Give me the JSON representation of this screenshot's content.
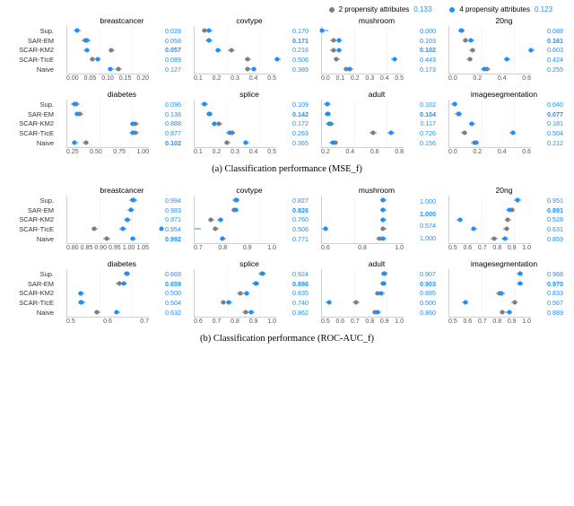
{
  "legend": {
    "a": {
      "label": "2 propensity attributes",
      "value": "0.133"
    },
    "b": {
      "label": "4 propensity attributes",
      "value": "0.123"
    }
  },
  "methods": [
    "Sup.",
    "SAR-EM",
    "SCAR-KM2",
    "SCAR-TIcE",
    "Naive"
  ],
  "captions": {
    "a": "(a) Classification performance (MSE_f)",
    "b": "(b) Classification performance (ROC-AUC_f)"
  },
  "groups": {
    "a": {
      "row1": [
        {
          "title": "breastcancer",
          "xmin": 0.0,
          "xmax": 0.24,
          "xticks": [
            "0.00",
            "0.05",
            "0.10",
            "0.15",
            "0.20"
          ],
          "vals": [
            "0.028",
            "0.058",
            "0.057",
            "0.089",
            "0.127"
          ],
          "bold": 2,
          "pts": [
            {
              "g": 0.03,
              "b": 0.028
            },
            {
              "g": 0.052,
              "b": 0.058
            },
            {
              "g": 0.13,
              "b": 0.057
            },
            {
              "g": 0.075,
              "b": 0.089
            },
            {
              "g": 0.15,
              "b": 0.127
            }
          ]
        },
        {
          "title": "covtype",
          "xmin": 0.1,
          "xmax": 0.5,
          "xticks": [
            "0.1",
            "0.2",
            "0.3",
            "0.4",
            "0.5"
          ],
          "vals": [
            "0.170",
            "0.171",
            "0.216",
            "0.506",
            "0.389"
          ],
          "bold": 1,
          "pts": [
            {
              "g": 0.15,
              "b": 0.17
            },
            {
              "g": 0.17,
              "b": 0.171
            },
            {
              "g": 0.28,
              "b": 0.216
            },
            {
              "g": 0.36,
              "b": 0.506
            },
            {
              "g": 0.36,
              "b": 0.389
            }
          ]
        },
        {
          "title": "mushroom",
          "xmin": 0.0,
          "xmax": 0.5,
          "xticks": [
            "0.0",
            "0.1",
            "0.2",
            "0.3",
            "0.4",
            "0.5"
          ],
          "vals": [
            "0.000",
            "0.103",
            "0.102",
            "0.443",
            "0.173"
          ],
          "bold": 2,
          "pts": [
            {
              "g": 0.0,
              "b": 0.0
            },
            {
              "g": 0.07,
              "b": 0.103
            },
            {
              "g": 0.07,
              "b": 0.102
            },
            {
              "g": 0.09,
              "b": 0.443
            },
            {
              "g": 0.15,
              "b": 0.173
            }
          ]
        },
        {
          "title": "20ng",
          "xmin": 0.0,
          "xmax": 0.6,
          "xticks": [
            "0.0",
            "0.2",
            "0.4",
            "0.6"
          ],
          "vals": [
            "0.088",
            "0.161",
            "0.603",
            "0.424",
            "0.255"
          ],
          "bold": 1,
          "pts": [
            {
              "g": 0.09,
              "b": 0.088
            },
            {
              "g": 0.12,
              "b": 0.161
            },
            {
              "g": 0.17,
              "b": 0.603
            },
            {
              "g": 0.15,
              "b": 0.424
            },
            {
              "g": 0.28,
              "b": 0.255
            }
          ]
        }
      ],
      "row2": [
        {
          "title": "diabetes",
          "xmin": 0.0,
          "xmax": 1.1,
          "xticks": [
            "0.25",
            "0.50",
            "0.75",
            "1.00"
          ],
          "vals": [
            "0.096",
            "0.138",
            "0.888",
            "0.877",
            "0.102"
          ],
          "bold": 4,
          "pts": [
            {
              "g": 0.12,
              "b": 0.096
            },
            {
              "g": 0.17,
              "b": 0.138
            },
            {
              "g": 0.92,
              "b": 0.888
            },
            {
              "g": 0.92,
              "b": 0.877
            },
            {
              "g": 0.25,
              "b": 0.102
            }
          ]
        },
        {
          "title": "splice",
          "xmin": 0.05,
          "xmax": 0.55,
          "xticks": [
            "0.1",
            "0.2",
            "0.3",
            "0.4",
            "0.5"
          ],
          "vals": [
            "0.109",
            "0.142",
            "0.172",
            "0.263",
            "0.365"
          ],
          "bold": 1,
          "pts": [
            {
              "g": 0.11,
              "b": 0.109
            },
            {
              "g": 0.14,
              "b": 0.142
            },
            {
              "g": 0.2,
              "b": 0.172
            },
            {
              "g": 0.28,
              "b": 0.263
            },
            {
              "g": 0.25,
              "b": 0.365
            }
          ]
        },
        {
          "title": "adult",
          "xmin": 0.05,
          "xmax": 0.85,
          "xticks": [
            "0.2",
            "0.4",
            "0.6",
            "0.8"
          ],
          "vals": [
            "0.102",
            "0.104",
            "0.117",
            "0.726",
            "0.156"
          ],
          "bold": 1,
          "pts": [
            {
              "g": 0.1,
              "b": 0.102
            },
            {
              "g": 0.11,
              "b": 0.104
            },
            {
              "g": 0.14,
              "b": 0.117
            },
            {
              "g": 0.55,
              "b": 0.726
            },
            {
              "g": 0.18,
              "b": 0.156
            }
          ]
        },
        {
          "title": "imagesegmentation",
          "xmin": 0.0,
          "xmax": 0.65,
          "xticks": [
            "0.0",
            "0.2",
            "0.4",
            "0.6"
          ],
          "vals": [
            "0.040",
            "0.077",
            "0.181",
            "0.504",
            "0.212"
          ],
          "bold": 1,
          "pts": [
            {
              "g": 0.04,
              "b": 0.04
            },
            {
              "g": 0.07,
              "b": 0.077
            },
            {
              "g": 0.18,
              "b": 0.181
            },
            {
              "g": 0.12,
              "b": 0.504
            },
            {
              "g": 0.2,
              "b": 0.212
            }
          ]
        }
      ]
    },
    "b": {
      "row1": [
        {
          "title": "breastcancer",
          "xmin": 0.75,
          "xmax": 1.05,
          "xticks": [
            "0.80",
            "0.85",
            "0.90",
            "0.95",
            "1.00",
            "1.05"
          ],
          "vals": [
            "0.994",
            "0.983",
            "0.971",
            "0.954",
            "0.992"
          ],
          "bold": 4,
          "pts": [
            {
              "g": 0.99,
              "b": 0.994
            },
            {
              "g": 0.985,
              "b": 0.983
            },
            {
              "g": 0.97,
              "b": 0.971
            },
            {
              "g": 0.85,
              "b": 0.954
            },
            {
              "g": 0.895,
              "b": 0.992
            }
          ]
        },
        {
          "title": "covtype",
          "xmin": 0.65,
          "xmax": 1.0,
          "xticks": [
            "0.7",
            "0.8",
            "0.9",
            "1.0"
          ],
          "vals": [
            "0.827",
            "0.826",
            "0.760",
            "0.506",
            "0.771"
          ],
          "bold": 1,
          "pts": [
            {
              "g": 0.83,
              "b": 0.827
            },
            {
              "g": 0.82,
              "b": 0.826
            },
            {
              "g": 0.72,
              "b": 0.76
            },
            {
              "g": 0.74,
              "b": 0.506
            },
            {
              "g": 0.77,
              "b": 0.771
            }
          ]
        },
        {
          "title": "mushroom",
          "xmin": 0.55,
          "xmax": 1.15,
          "xticks": [
            "0.6",
            "0.8",
            "1.0"
          ],
          "vals": [
            "1.000",
            "1.000",
            "0.574",
            "1.000"
          ],
          "bold": 1,
          "pts": [
            {
              "g": 1.0,
              "b": 1.0
            },
            {
              "g": 1.0,
              "b": 1.0
            },
            {
              "g": 1.0,
              "b": 1.0
            },
            {
              "g": 1.0,
              "b": 0.574
            },
            {
              "g": 0.97,
              "b": 1.0
            }
          ]
        },
        {
          "title": "20ng",
          "xmin": 0.45,
          "xmax": 1.05,
          "xticks": [
            "0.5",
            "0.6",
            "0.7",
            "0.8",
            "0.9",
            "1.0"
          ],
          "vals": [
            "0.951",
            "0.891",
            "0.528",
            "0.631",
            "0.859"
          ],
          "bold": 1,
          "pts": [
            {
              "g": 0.95,
              "b": 0.951
            },
            {
              "g": 0.91,
              "b": 0.891
            },
            {
              "g": 0.88,
              "b": 0.528
            },
            {
              "g": 0.87,
              "b": 0.631
            },
            {
              "g": 0.78,
              "b": 0.859
            }
          ]
        }
      ],
      "row2": [
        {
          "title": "diabetes",
          "xmin": 0.45,
          "xmax": 0.75,
          "xticks": [
            "0.5",
            "0.6",
            "0.7"
          ],
          "vals": [
            "0.669",
            "0.659",
            "0.500",
            "0.504",
            "0.632"
          ],
          "bold": 1,
          "pts": [
            {
              "g": 0.67,
              "b": 0.669
            },
            {
              "g": 0.64,
              "b": 0.659
            },
            {
              "g": 0.5,
              "b": 0.5
            },
            {
              "g": 0.5,
              "b": 0.504
            },
            {
              "g": 0.56,
              "b": 0.632
            }
          ]
        },
        {
          "title": "splice",
          "xmin": 0.55,
          "xmax": 1.0,
          "xticks": [
            "0.6",
            "0.7",
            "0.8",
            "0.9",
            "1.0"
          ],
          "vals": [
            "0.924",
            "0.886",
            "0.835",
            "0.740",
            "0.862"
          ],
          "bold": 1,
          "pts": [
            {
              "g": 0.92,
              "b": 0.924
            },
            {
              "g": 0.89,
              "b": 0.886
            },
            {
              "g": 0.8,
              "b": 0.835
            },
            {
              "g": 0.71,
              "b": 0.74
            },
            {
              "g": 0.83,
              "b": 0.862
            }
          ]
        },
        {
          "title": "adult",
          "xmin": 0.45,
          "xmax": 1.05,
          "xticks": [
            "0.5",
            "0.6",
            "0.7",
            "0.8",
            "0.9",
            "1.0"
          ],
          "vals": [
            "0.907",
            "0.903",
            "0.885",
            "0.500",
            "0.860"
          ],
          "bold": 1,
          "pts": [
            {
              "g": 0.91,
              "b": 0.907
            },
            {
              "g": 0.9,
              "b": 0.903
            },
            {
              "g": 0.86,
              "b": 0.885
            },
            {
              "g": 0.7,
              "b": 0.5
            },
            {
              "g": 0.84,
              "b": 0.86
            }
          ]
        },
        {
          "title": "imagesegmentation",
          "xmin": 0.45,
          "xmax": 1.05,
          "xticks": [
            "0.5",
            "0.6",
            "0.7",
            "0.8",
            "0.9",
            "1.0"
          ],
          "vals": [
            "0.968",
            "0.970",
            "0.833",
            "0.567",
            "0.889"
          ],
          "bold": 1,
          "pts": [
            {
              "g": 0.97,
              "b": 0.968
            },
            {
              "g": 0.97,
              "b": 0.97
            },
            {
              "g": 0.82,
              "b": 0.833
            },
            {
              "g": 0.93,
              "b": 0.567
            },
            {
              "g": 0.84,
              "b": 0.889
            }
          ]
        }
      ]
    }
  },
  "chart_data": {
    "type": "scatter",
    "note": "Dot plots comparing methods across datasets, two propensity-attribute settings (grey=2, blue=4). Values shown at right of each panel correspond to the blue (4-attribute) series. Panel (a) metric=MSE_f (lower better), panel (b) metric=ROC-AUC_f (higher better).",
    "methods": [
      "Sup.",
      "SAR-EM",
      "SCAR-KM2",
      "SCAR-TIcE",
      "Naive"
    ],
    "panels": [
      {
        "group": "a",
        "dataset": "breastcancer",
        "blue": [
          0.028,
          0.058,
          0.057,
          0.089,
          0.127
        ],
        "grey": [
          0.03,
          0.052,
          0.13,
          0.075,
          0.15
        ]
      },
      {
        "group": "a",
        "dataset": "covtype",
        "blue": [
          0.17,
          0.171,
          0.216,
          0.506,
          0.389
        ],
        "grey": [
          0.15,
          0.17,
          0.28,
          0.36,
          0.36
        ]
      },
      {
        "group": "a",
        "dataset": "mushroom",
        "blue": [
          0.0,
          0.103,
          0.102,
          0.443,
          0.173
        ],
        "grey": [
          0.0,
          0.07,
          0.07,
          0.09,
          0.15
        ]
      },
      {
        "group": "a",
        "dataset": "20ng",
        "blue": [
          0.088,
          0.161,
          0.603,
          0.424,
          0.255
        ],
        "grey": [
          0.09,
          0.12,
          0.17,
          0.15,
          0.28
        ]
      },
      {
        "group": "a",
        "dataset": "diabetes",
        "blue": [
          0.096,
          0.138,
          0.888,
          0.877,
          0.102
        ],
        "grey": [
          0.12,
          0.17,
          0.92,
          0.92,
          0.25
        ]
      },
      {
        "group": "a",
        "dataset": "splice",
        "blue": [
          0.109,
          0.142,
          0.172,
          0.263,
          0.365
        ],
        "grey": [
          0.11,
          0.14,
          0.2,
          0.28,
          0.25
        ]
      },
      {
        "group": "a",
        "dataset": "adult",
        "blue": [
          0.102,
          0.104,
          0.117,
          0.726,
          0.156
        ],
        "grey": [
          0.1,
          0.11,
          0.14,
          0.55,
          0.18
        ]
      },
      {
        "group": "a",
        "dataset": "imagesegmentation",
        "blue": [
          0.04,
          0.077,
          0.181,
          0.504,
          0.212
        ],
        "grey": [
          0.04,
          0.07,
          0.18,
          0.12,
          0.2
        ]
      },
      {
        "group": "b",
        "dataset": "breastcancer",
        "blue": [
          0.994,
          0.983,
          0.971,
          0.954,
          0.992
        ],
        "grey": [
          0.99,
          0.985,
          0.97,
          0.85,
          0.895
        ]
      },
      {
        "group": "b",
        "dataset": "covtype",
        "blue": [
          0.827,
          0.826,
          0.76,
          0.506,
          0.771
        ],
        "grey": [
          0.83,
          0.82,
          0.72,
          0.74,
          0.77
        ]
      },
      {
        "group": "b",
        "dataset": "mushroom",
        "blue": [
          1.0,
          1.0,
          1.0,
          0.574,
          1.0
        ],
        "grey": [
          1.0,
          1.0,
          1.0,
          1.0,
          0.97
        ]
      },
      {
        "group": "b",
        "dataset": "20ng",
        "blue": [
          0.951,
          0.891,
          0.528,
          0.631,
          0.859
        ],
        "grey": [
          0.95,
          0.91,
          0.88,
          0.87,
          0.78
        ]
      },
      {
        "group": "b",
        "dataset": "diabetes",
        "blue": [
          0.669,
          0.659,
          0.5,
          0.504,
          0.632
        ],
        "grey": [
          0.67,
          0.64,
          0.5,
          0.5,
          0.56
        ]
      },
      {
        "group": "b",
        "dataset": "splice",
        "blue": [
          0.924,
          0.886,
          0.835,
          0.74,
          0.862
        ],
        "grey": [
          0.92,
          0.89,
          0.8,
          0.71,
          0.83
        ]
      },
      {
        "group": "b",
        "dataset": "adult",
        "blue": [
          0.907,
          0.903,
          0.885,
          0.5,
          0.86
        ],
        "grey": [
          0.91,
          0.9,
          0.86,
          0.7,
          0.84
        ]
      },
      {
        "group": "b",
        "dataset": "imagesegmentation",
        "blue": [
          0.968,
          0.97,
          0.833,
          0.567,
          0.889
        ],
        "grey": [
          0.97,
          0.97,
          0.82,
          0.93,
          0.84
        ]
      }
    ]
  }
}
